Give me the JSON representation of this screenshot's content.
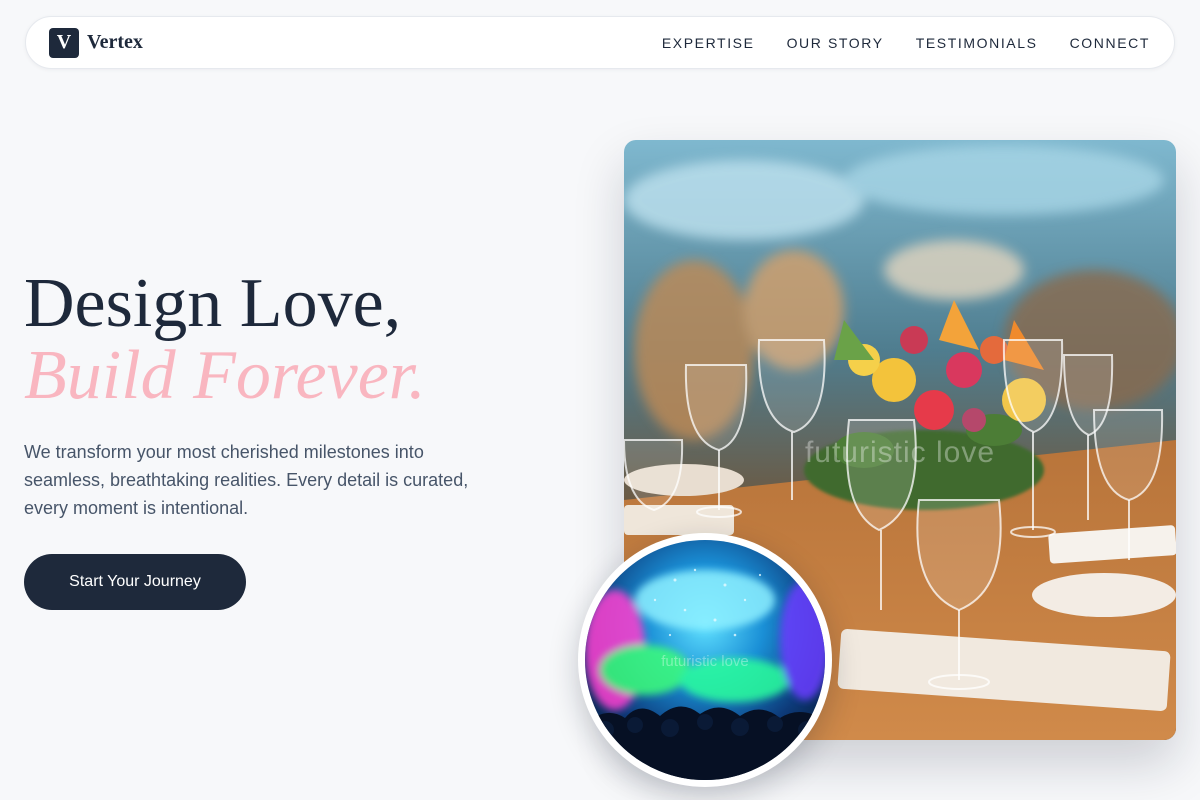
{
  "brand": {
    "mark": "V",
    "name": "Vertex"
  },
  "nav": {
    "links": [
      "EXPERTISE",
      "OUR STORY",
      "TESTIMONIALS",
      "CONNECT"
    ]
  },
  "hero": {
    "headline_line1": "Design Love,",
    "headline_line2": "Build Forever.",
    "description": "We transform your most cherished milestones into seamless, breathtaking realities. Every detail is curated, every moment is intentional.",
    "cta_label": "Start Your Journey"
  },
  "images": {
    "main_caption": "futuristic love",
    "circle_caption": "futuristic love"
  },
  "colors": {
    "primary": "#1e293b",
    "accent_pink": "#f9b6c0",
    "background": "#f7f8fa",
    "muted_text": "#475569"
  }
}
